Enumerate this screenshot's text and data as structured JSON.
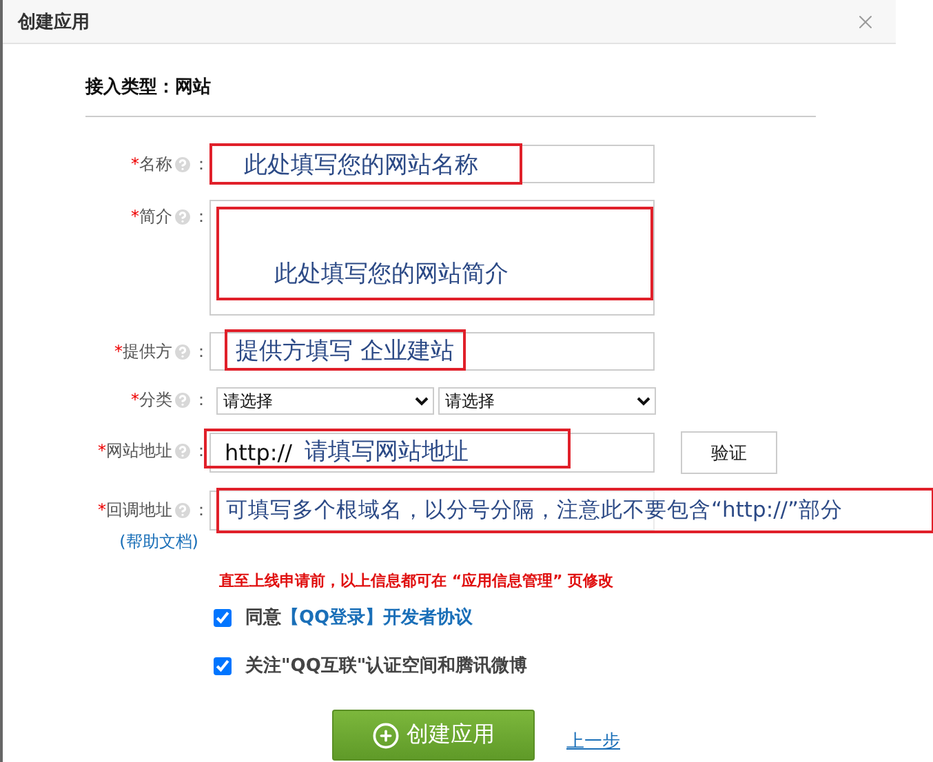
{
  "dialog": {
    "title": "创建应用"
  },
  "access_type": "接入类型：网站",
  "fields": [
    {
      "kind": "text",
      "mark": "*",
      "label": "名称",
      "colon": "：",
      "annotation": "此处填写您的网站名称"
    },
    {
      "kind": "textarea",
      "mark": "*",
      "label": "简介",
      "colon": "：",
      "annotation": "此处填写您的网站简介"
    },
    {
      "kind": "text",
      "mark": "*",
      "label": "提供方",
      "colon": "：",
      "annotation": "提供方填写 企业建站"
    },
    {
      "kind": "selects",
      "mark": "*",
      "label": "分类",
      "colon": "：",
      "options": [
        "请选择",
        "请选择"
      ]
    },
    {
      "kind": "url",
      "mark": "*",
      "label": "网站地址",
      "colon": "：",
      "value": "http://",
      "annotation": "请填写网站地址",
      "button": "验证"
    },
    {
      "kind": "wide",
      "mark": "*",
      "label": "回调地址",
      "colon": "：",
      "annotation": "可填写多个根域名，以分号分隔，注意此不要包含“http://”部分",
      "help_link": "(帮助文档)"
    }
  ],
  "notice": "直至上线申请前，以上信息都可在 “应用信息管理” 页修改",
  "checkboxes": [
    {
      "text": "同意",
      "link": "【QQ登录】开发者协议",
      "checked": true
    },
    {
      "text": "关注\"QQ互联\"认证空间和腾讯微博",
      "checked": true
    }
  ],
  "submit": "创建应用",
  "back": "上一步"
}
